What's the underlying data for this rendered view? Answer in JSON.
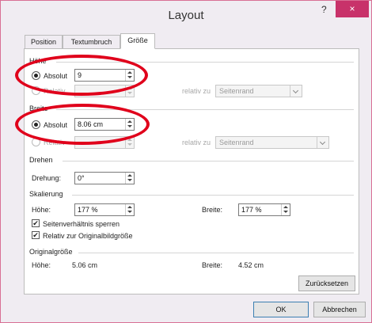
{
  "window": {
    "title": "Layout",
    "help_label": "?",
    "close_label": "×"
  },
  "tabs": [
    {
      "label": "Position"
    },
    {
      "label": "Textumbruch"
    },
    {
      "label": "Größe"
    }
  ],
  "hoehe": {
    "section": "Höhe",
    "absolut_label": "Absolut",
    "absolut_value": "9",
    "relativ_label": "Relativ",
    "relativ_zu_label": "relativ zu",
    "relativ_zu_value": "Seitenrand"
  },
  "breite": {
    "section": "Breite",
    "absolut_label": "Absolut",
    "absolut_value": "8.06  cm",
    "relativ_label": "Relativ",
    "relativ_zu_label": "relativ zu",
    "relativ_zu_value": "Seitenrand"
  },
  "drehen": {
    "section": "Drehen",
    "drehung_label": "Drehung:",
    "drehung_value": "0°"
  },
  "skalierung": {
    "section": "Skalierung",
    "hoehe_label": "Höhe:",
    "hoehe_value": "177 %",
    "breite_label": "Breite:",
    "breite_value": "177 %",
    "lock_label": "Seitenverhältnis sperren",
    "lock_checked": true,
    "relative_label": "Relativ zur Originalbildgröße",
    "relative_checked": true
  },
  "original": {
    "section": "Originalgröße",
    "hoehe_label": "Höhe:",
    "hoehe_value": "5.06  cm",
    "breite_label": "Breite:",
    "breite_value": "4.52  cm",
    "reset_label": "Zurücksetzen"
  },
  "footer": {
    "ok_label": "OK",
    "cancel_label": "Abbrechen"
  },
  "colors": {
    "annotation": "#e0001b",
    "close_button": "#c8326a",
    "window_border": "#d86f94"
  }
}
